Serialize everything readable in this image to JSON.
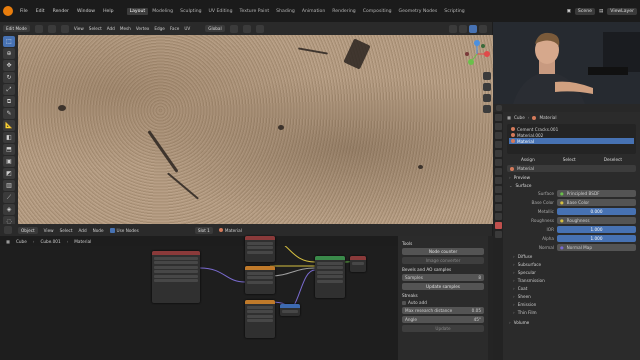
{
  "topbar": {
    "menus": [
      "File",
      "Edit",
      "Render",
      "Window",
      "Help"
    ],
    "workspaces": [
      "Layout",
      "Modeling",
      "Sculpting",
      "UV Editing",
      "Texture Paint",
      "Shading",
      "Animation",
      "Rendering",
      "Compositing",
      "Geometry Nodes",
      "Scripting"
    ],
    "active_workspace": "Layout",
    "scene": "Scene",
    "view_layer": "ViewLayer"
  },
  "viewport_header": {
    "mode": "Edit Mode",
    "menus": [
      "View",
      "Select",
      "Add",
      "Mesh",
      "Vertex",
      "Edge",
      "Face",
      "UV"
    ],
    "orientation": "Global",
    "options": "Options"
  },
  "node_header": {
    "editor": "Object",
    "menus": [
      "View",
      "Select",
      "Add",
      "Node"
    ],
    "use_nodes": "Use Nodes",
    "slot": "Slot 1",
    "material": "Material"
  },
  "node_breadcrumb": [
    "Cube",
    "Cube.001",
    "Material"
  ],
  "npanel": {
    "tools_title": "Tools",
    "node_counter": "Node counter",
    "image_converter": "Image converter",
    "bevels_title": "Bevels and AO samples",
    "samples_label": "Samples",
    "samples_value": "8",
    "update_samples": "Update samples",
    "streaks_title": "Streaks",
    "auto_add": "Auto add",
    "max_distance_label": "Max research distance",
    "max_distance_value": "0.05",
    "angle_label": "Angle",
    "angle_value": "45°",
    "update": "Update"
  },
  "properties": {
    "object": "Cube",
    "material_tab": "Material",
    "slots": [
      "Cement Cracks.001",
      "Material.002",
      "Material"
    ],
    "selected_slot": 2,
    "link_buttons": [
      "Assign",
      "Select",
      "Deselect"
    ],
    "material_name": "Material",
    "preview": "Preview",
    "surface": "Surface",
    "surface_label": "Surface",
    "surface_value": "Principled BSDF",
    "base_color_label": "Base Color",
    "base_color_value": "Base Color",
    "metallic_label": "Metallic",
    "metallic_value": "0.000",
    "roughness_label": "Roughness",
    "roughness_value": "Roughness",
    "ior_label": "IOR",
    "ior_value": "1.000",
    "alpha_label": "Alpha",
    "alpha_value": "1.000",
    "normal_label": "Normal",
    "normal_value": "Normal Map",
    "subsections": [
      "Diffuse",
      "Subsurface",
      "Specular",
      "Transmission",
      "Coat",
      "Sheen",
      "Emission",
      "Thin Film"
    ],
    "volume": "Volume"
  },
  "colors": {
    "accent": "#4772b3",
    "orange": "#e87d0d",
    "panel": "#2b2b2b"
  }
}
